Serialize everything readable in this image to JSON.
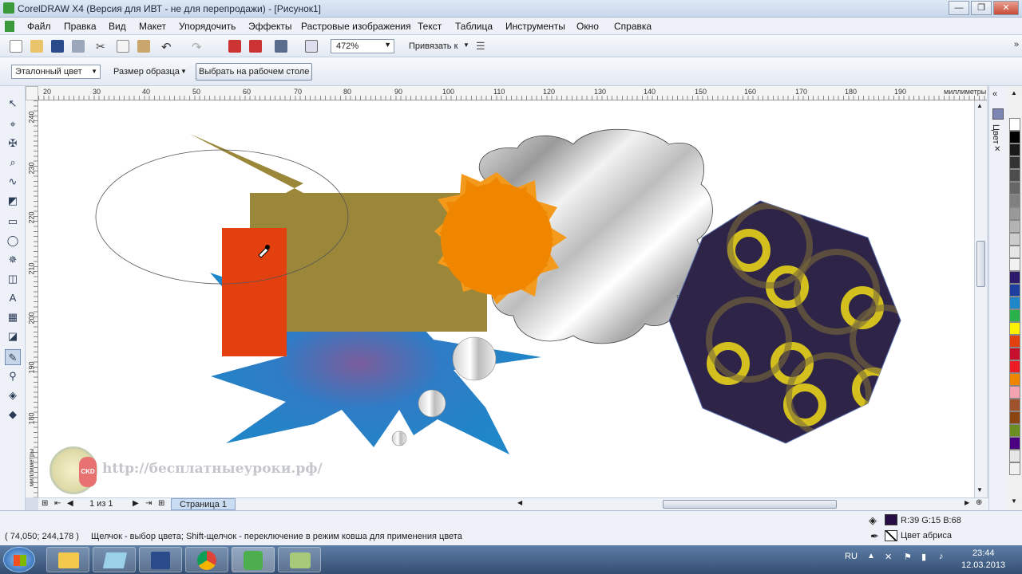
{
  "window": {
    "title": "CorelDRAW X4 (Версия для ИВТ - не для перепродажи) - [Рисунок1]",
    "controls": [
      "—",
      "❐",
      "✕"
    ]
  },
  "menu": [
    "Файл",
    "Правка",
    "Вид",
    "Макет",
    "Упорядочить",
    "Эффекты",
    "Растровые изображения",
    "Текст",
    "Таблица",
    "Инструменты",
    "Окно",
    "Справка"
  ],
  "toolbar": {
    "zoom": "472%",
    "snap_label": "Привязать к"
  },
  "property_bar": {
    "reference_color": "Эталонный цвет",
    "sample_size": "Размер образца",
    "select_desktop": "Выбрать на рабочем столе"
  },
  "rulers": {
    "h_ticks": [
      "20",
      "30",
      "40",
      "50",
      "60",
      "70",
      "80",
      "90",
      "100",
      "110",
      "120",
      "130",
      "140",
      "150",
      "160",
      "170",
      "180",
      "190"
    ],
    "h_unit": "миллиметры",
    "v_ticks": [
      "240",
      "230",
      "220",
      "210",
      "200",
      "190",
      "180"
    ],
    "v_unit": "миллиметры"
  },
  "docker": {
    "tab_label": "Цвет"
  },
  "pages": {
    "counter": "1 из 1",
    "tab": "Страница 1"
  },
  "watermark": {
    "text": "http://бесплатныеуроки.рф/",
    "logo": "CKD"
  },
  "status": {
    "coords": "( 74,050; 244,178 )",
    "hint": "Щелчок - выбор цвета; Shift-щелчок - переключение в режим ковша для применения цвета",
    "fill_value": "R:39 G:15 B:68",
    "fill_color": "#270f44",
    "outline_label": "Цвет абриса"
  },
  "tray": {
    "lang": "RU",
    "time": "23:44",
    "date": "12.03.2013"
  },
  "colors": {
    "olive": "#9b8739",
    "orange_red": "#e3400f",
    "orange": "#f08500",
    "blue": "#1f86c8",
    "purple_dark": "#2e2447"
  },
  "palette": [
    "#ffffff",
    "#000000",
    "#1a1a1a",
    "#333333",
    "#4d4d4d",
    "#666666",
    "#808080",
    "#999999",
    "#b3b3b3",
    "#cccccc",
    "#e6e6e6",
    "#f2f2f2",
    "#2e1a6b",
    "#1f3fa0",
    "#1f86c8",
    "#2ab34a",
    "#fff200",
    "#e3400f",
    "#c8102e",
    "#ed1c24",
    "#f08500",
    "#f4a3b0",
    "#a0522d",
    "#8b4513",
    "#6b8e23",
    "#4b0082",
    "#e6e6e6",
    "#f0f0f0"
  ]
}
